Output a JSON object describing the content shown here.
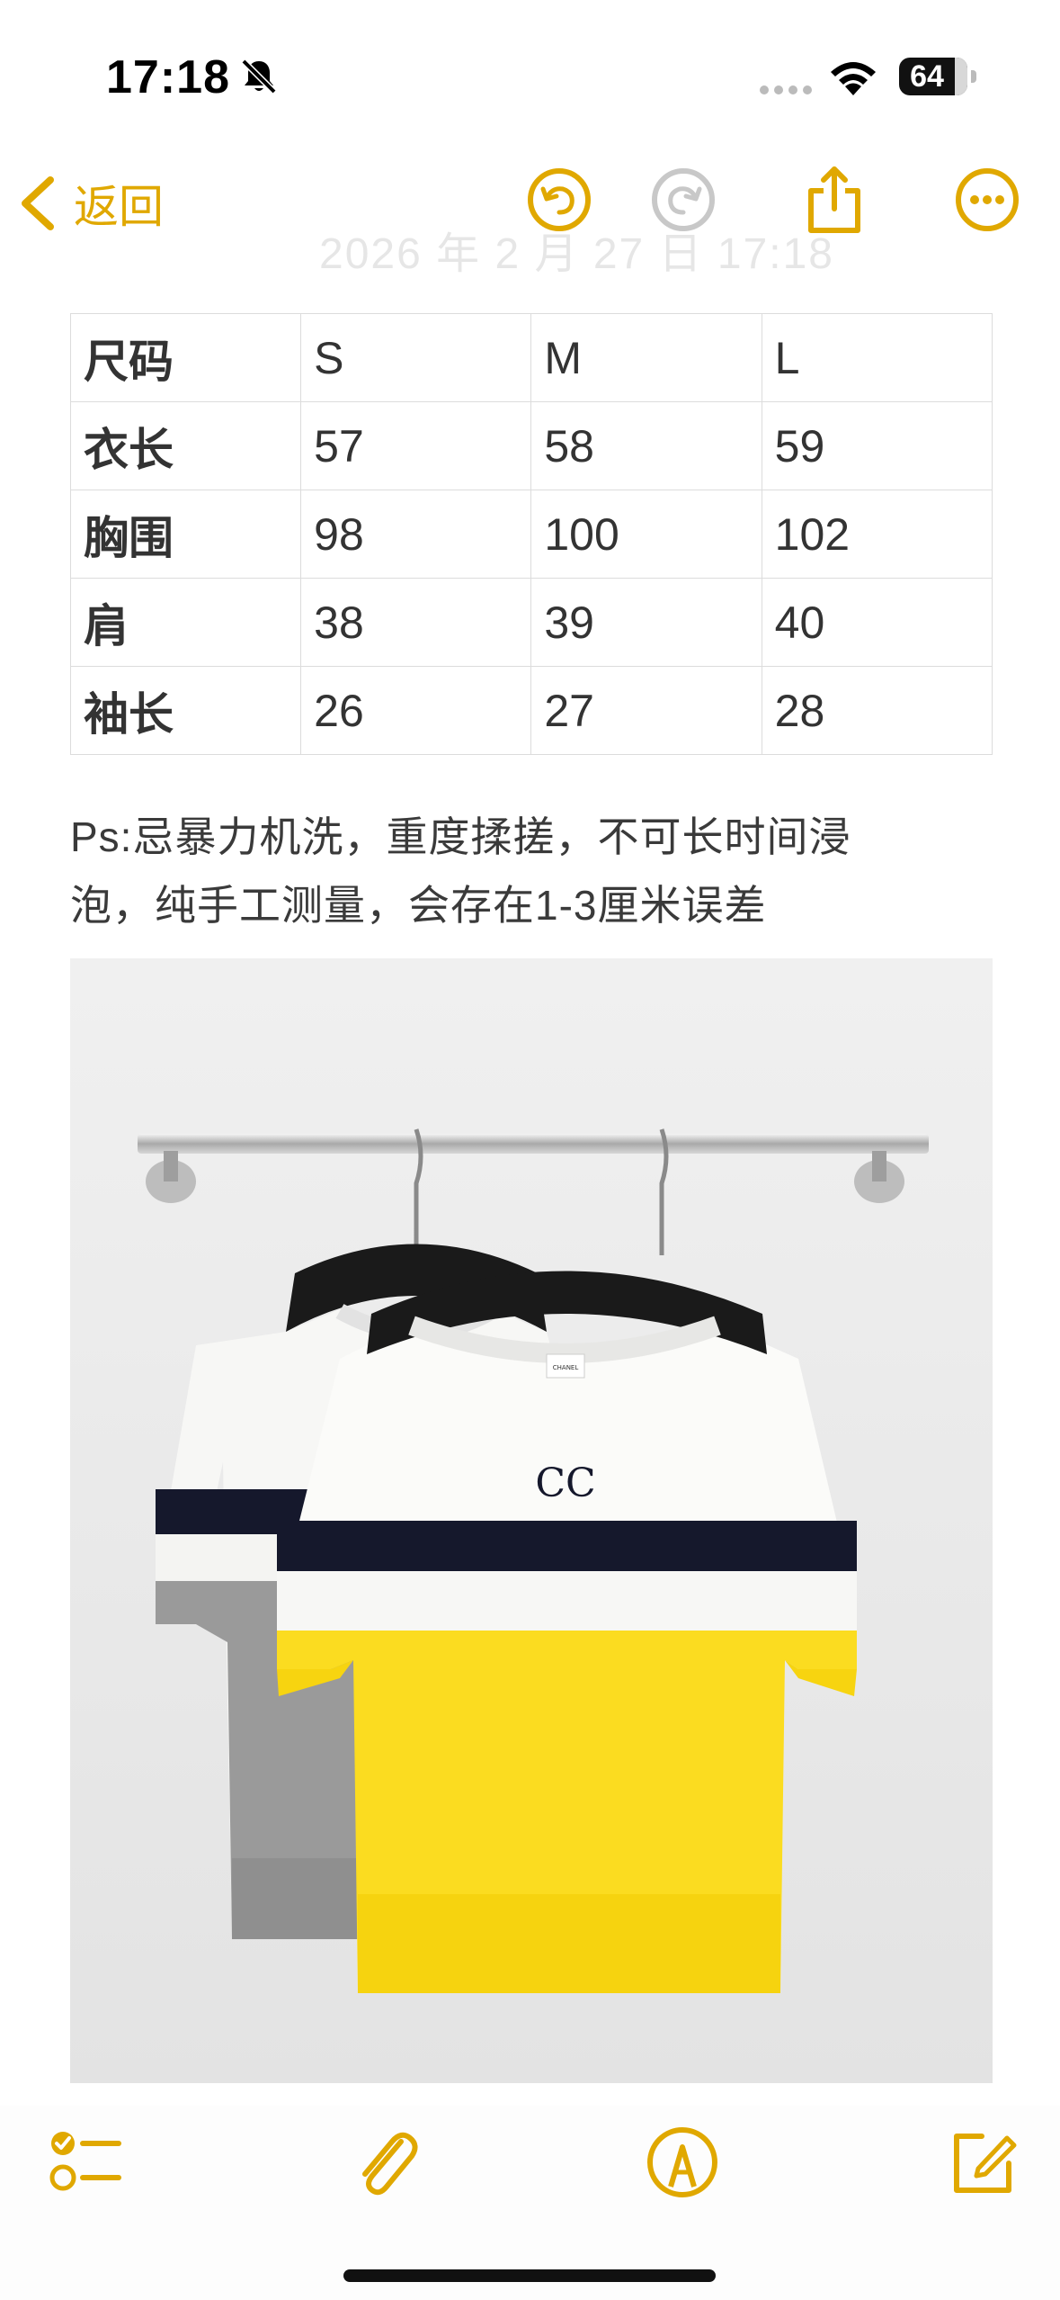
{
  "status_bar": {
    "time": "17:18",
    "battery_level": "64",
    "icons": [
      "bell-slash-icon",
      "cellular-signal-icon",
      "wifi-icon",
      "battery-icon"
    ]
  },
  "nav": {
    "back_label": "返回",
    "date_text": "2026 年 2 月 27 日 17:18",
    "icons": [
      "chevron-left-icon",
      "undo-icon",
      "redo-icon",
      "share-icon",
      "more-icon"
    ]
  },
  "size_table": {
    "rows": [
      {
        "label": "尺码",
        "values": [
          "S",
          "M",
          "L"
        ]
      },
      {
        "label": "衣长",
        "values": [
          "57",
          "58",
          "59"
        ]
      },
      {
        "label": "胸围",
        "values": [
          "98",
          "100",
          "102"
        ]
      },
      {
        "label": "肩",
        "values": [
          "38",
          "39",
          "40"
        ]
      },
      {
        "label": "袖长",
        "values": [
          "26",
          "27",
          "28"
        ]
      }
    ]
  },
  "note": {
    "line1": "Ps:忌暴力机洗，重度揉搓，不可长时间浸",
    "line2": "泡，纯手工测量，会存在1-3厘米误差"
  },
  "photo": {
    "brand_mark": "CC",
    "tag_text": "CHANEL"
  },
  "toolbar": {
    "icons": [
      "checklist-icon",
      "paperclip-icon",
      "markup-pen-icon",
      "compose-icon"
    ]
  },
  "colors": {
    "accent": "#E0A800",
    "disabled": "#C8C8C8"
  }
}
